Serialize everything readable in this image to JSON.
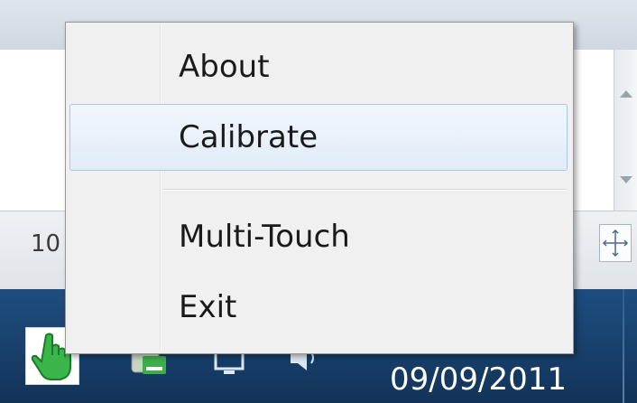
{
  "background_window": {
    "status_text": "10"
  },
  "taskbar": {
    "date": "09/09/2011",
    "tray_icons": [
      "multi-touch-hand-icon",
      "network-icon",
      "monitor-icon",
      "speaker-icon"
    ]
  },
  "context_menu": {
    "items": [
      {
        "label": "About"
      },
      {
        "label": "Calibrate"
      },
      {
        "label": "Multi-Touch"
      },
      {
        "label": "Exit"
      }
    ],
    "highlighted_item": "Calibrate",
    "highlight_color": "#a8c7ea"
  }
}
